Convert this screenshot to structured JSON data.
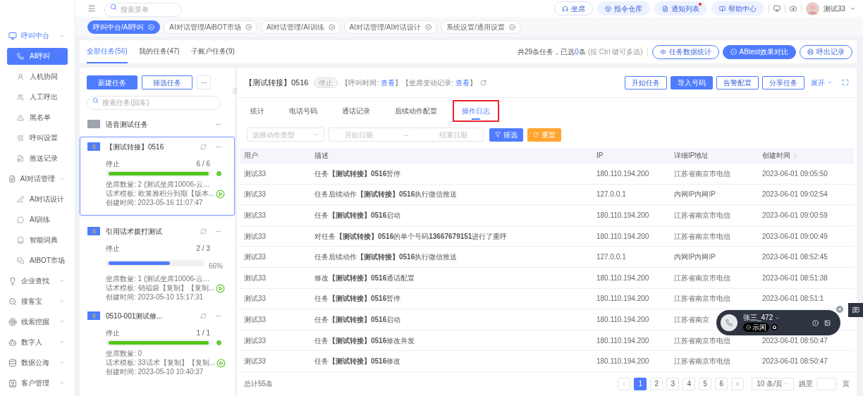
{
  "header": {
    "search": {
      "placeholder": "搜索菜单"
    },
    "buttons": [
      {
        "label": "坐席",
        "kind": "outline",
        "dot": false
      },
      {
        "label": "指令仓库",
        "kind": "soft",
        "dot": false
      },
      {
        "label": "通知列表",
        "kind": "soft",
        "dot": true
      },
      {
        "label": "帮助中心",
        "kind": "soft",
        "dot": false
      }
    ],
    "user": "测试33"
  },
  "page_tabs": [
    {
      "label": "呼叫中台/AI呼叫",
      "selected": true
    },
    {
      "label": "AI对话管理/AiBOT市场",
      "selected": false
    },
    {
      "label": "AI对话管理/AI训练",
      "selected": false
    },
    {
      "label": "AI对话管理/AI对话设计",
      "selected": false
    },
    {
      "label": "系统设置/通用设置",
      "selected": false
    }
  ],
  "sidebar": {
    "groups": [
      {
        "label": "呼叫中台",
        "expanded": true,
        "active": true,
        "children": [
          {
            "label": "AI呼叫",
            "selected": true
          },
          {
            "label": "人机协同",
            "selected": false
          },
          {
            "label": "人工呼出",
            "selected": false
          },
          {
            "label": "黑名单",
            "selected": false
          },
          {
            "label": "呼叫设置",
            "selected": false
          },
          {
            "label": "推送记录",
            "selected": false
          }
        ]
      },
      {
        "label": "AI对话管理",
        "expanded": true,
        "active": false,
        "children": [
          {
            "label": "AI对话设计",
            "selected": false
          },
          {
            "label": "AI训练",
            "selected": false
          },
          {
            "label": "智能词典",
            "selected": false
          },
          {
            "label": "AIBOT市场",
            "selected": false
          }
        ]
      },
      {
        "label": "企业查找",
        "expanded": false,
        "active": false
      },
      {
        "label": "搜客宝",
        "expanded": false,
        "active": false
      },
      {
        "label": "线索挖掘",
        "expanded": false,
        "active": false
      },
      {
        "label": "数字人",
        "expanded": false,
        "active": false
      },
      {
        "label": "数据公海",
        "expanded": false,
        "active": false
      },
      {
        "label": "客户管理",
        "expanded": false,
        "active": false
      }
    ]
  },
  "task_tabs": [
    {
      "label": "全部任务(56)",
      "selected": true
    },
    {
      "label": "我的任务(47)",
      "selected": false
    },
    {
      "label": "子账户任务(9)",
      "selected": false
    }
  ],
  "summary": {
    "prefix": "共29条任务，已选",
    "count": "0",
    "suffix": "条",
    "hint": "(按 Ctrl 键可多选)"
  },
  "toolbar": [
    {
      "label": "任务数据统计",
      "kind": "outline"
    },
    {
      "label": "ABtest效果对比",
      "kind": "primary"
    },
    {
      "label": "呼出记录",
      "kind": "outline"
    }
  ],
  "task_list": {
    "buttons": [
      {
        "label": "新建任务",
        "kind": "primary"
      },
      {
        "label": "筛选任务",
        "kind": "outline"
      }
    ],
    "search": {
      "placeholder": "搜索任务(回车)"
    },
    "tasks": [
      {
        "kind": "folder",
        "title": "语音测试任务",
        "selected": false
      },
      {
        "kind": "task",
        "title": "【测试转接】0516",
        "selected": true,
        "status": "停止",
        "count": "6 / 6",
        "level": 1,
        "complete": true,
        "agents": "坐席数量:  2 (测试坐席10006-云...",
        "script": "话术模板:  欧莱雅积分到期【版本...",
        "created": "创建时间:  2023-05-16 11:07:47"
      },
      {
        "kind": "task",
        "title": "引用话术拨打测试",
        "selected": false,
        "status": "停止",
        "count": "2 / 3",
        "level": 0.66,
        "complete": false,
        "percent": "66%",
        "agents": "坐席数量:  1 (测试坐席10006-云...",
        "script": "话术模板:  销福袋【复制】【复制...",
        "created": "创建时间:  2023-05-10 15:17:31"
      },
      {
        "kind": "task",
        "title": "0510-001测试修...",
        "selected": false,
        "status": "停止",
        "count": "1 / 1",
        "level": 1,
        "complete": true,
        "agents": "坐席数量:  0",
        "script": "话术模板:  33话术【复制】【复制...",
        "created": "创建时间:  2023-05-10 10:40:37"
      }
    ]
  },
  "detail": {
    "title": "【测试转接】0516",
    "status": "停止",
    "links": [
      {
        "label": "【呼叫时间:",
        "link": "查看"
      },
      {
        "label": "】【坐席变动记录:",
        "link": "查看"
      }
    ],
    "link_end": "】",
    "actions": [
      {
        "label": "开始任务",
        "kind": "outline"
      },
      {
        "label": "导入号码",
        "kind": "primary"
      },
      {
        "label": "告警配置",
        "kind": "outline"
      },
      {
        "label": "分享任务",
        "kind": "outline"
      }
    ],
    "expand": "展开",
    "tabs": [
      {
        "label": "统计",
        "selected": false,
        "highlighted": false
      },
      {
        "label": "电话号码",
        "selected": false,
        "highlighted": false
      },
      {
        "label": "通话记录",
        "selected": false,
        "highlighted": false
      },
      {
        "label": "后续动作配置",
        "selected": false,
        "highlighted": false
      },
      {
        "label": "操作日志",
        "selected": true,
        "highlighted": true
      }
    ],
    "filters": {
      "action_type": {
        "placeholder": "选择动作类型"
      },
      "start": {
        "placeholder": "开始日期"
      },
      "separator": "–",
      "end": {
        "placeholder": "结束日期"
      },
      "filter_button": "筛选",
      "reset_button": "重置"
    },
    "table": {
      "columns": [
        "用户",
        "描述",
        "IP",
        "详细IP地址",
        "创建时间"
      ],
      "rows": [
        {
          "user": "测试33",
          "description": "任务**【测试转接】0516**暂停",
          "ip": "180.110.194.200",
          "address": "江苏省南京市电信",
          "time": "2023-06-01 09:05:50"
        },
        {
          "user": "测试33",
          "description": "任务后续动作**【测试转接】0516**执行微信推送",
          "ip": "127.0.0.1",
          "address": "内网IP内网IP",
          "time": "2023-06-01 09:02:54"
        },
        {
          "user": "测试33",
          "description": "任务**【测试转接】0516**启动",
          "ip": "180.110.194.200",
          "address": "江苏省南京市电信",
          "time": "2023-06-01 09:00:59"
        },
        {
          "user": "测试33",
          "description": "对任务**【测试转接】0516**的单个号码**13667679151**进行了重呼",
          "ip": "180.110.194.200",
          "address": "江苏省南京市电信",
          "time": "2023-06-01 09:00:49"
        },
        {
          "user": "测试33",
          "description": "任务后续动作**【测试转接】0516**执行微信推送",
          "ip": "127.0.0.1",
          "address": "内网IP内网IP",
          "time": "2023-06-01 08:52:45"
        },
        {
          "user": "测试33",
          "description": "修改**【测试转接】0516**通话配置",
          "ip": "180.110.194.200",
          "address": "江苏省南京市电信",
          "time": "2023-06-01 08:51:38"
        },
        {
          "user": "测试33",
          "description": "任务**【测试转接】0516**暂停",
          "ip": "180.110.194.200",
          "address": "江苏省南京市电信",
          "time": "2023-06-01 08:51:1"
        },
        {
          "user": "测试33",
          "description": "任务**【测试转接】0516**启动",
          "ip": "180.110.194.200",
          "address": "江苏省南京"
        },
        {
          "user": "测试33",
          "description": "任务**【测试转接】0516**修改并发",
          "ip": "180.110.194.200",
          "address": "江苏省南京市电信",
          "time": "2023-06-01 08:50:47"
        },
        {
          "user": "测试33",
          "description": "任务**【测试转接】0516**修改",
          "ip": "180.110.194.200",
          "address": "江苏省南京市电信",
          "time": "2023-06-01 08:50:47"
        }
      ]
    },
    "pagination": {
      "total": "总计55条",
      "pages": [
        {
          "label": "1",
          "selected": true
        },
        {
          "label": "2",
          "selected": false
        },
        {
          "label": "3",
          "selected": false
        },
        {
          "label": "4",
          "selected": false
        },
        {
          "label": "5",
          "selected": false
        },
        {
          "label": "6",
          "selected": false
        }
      ],
      "page_size": "10 条/页",
      "jump": "跳至",
      "unit": "页"
    }
  },
  "call_widget": {
    "name": "张三_472",
    "status": "示闲"
  }
}
